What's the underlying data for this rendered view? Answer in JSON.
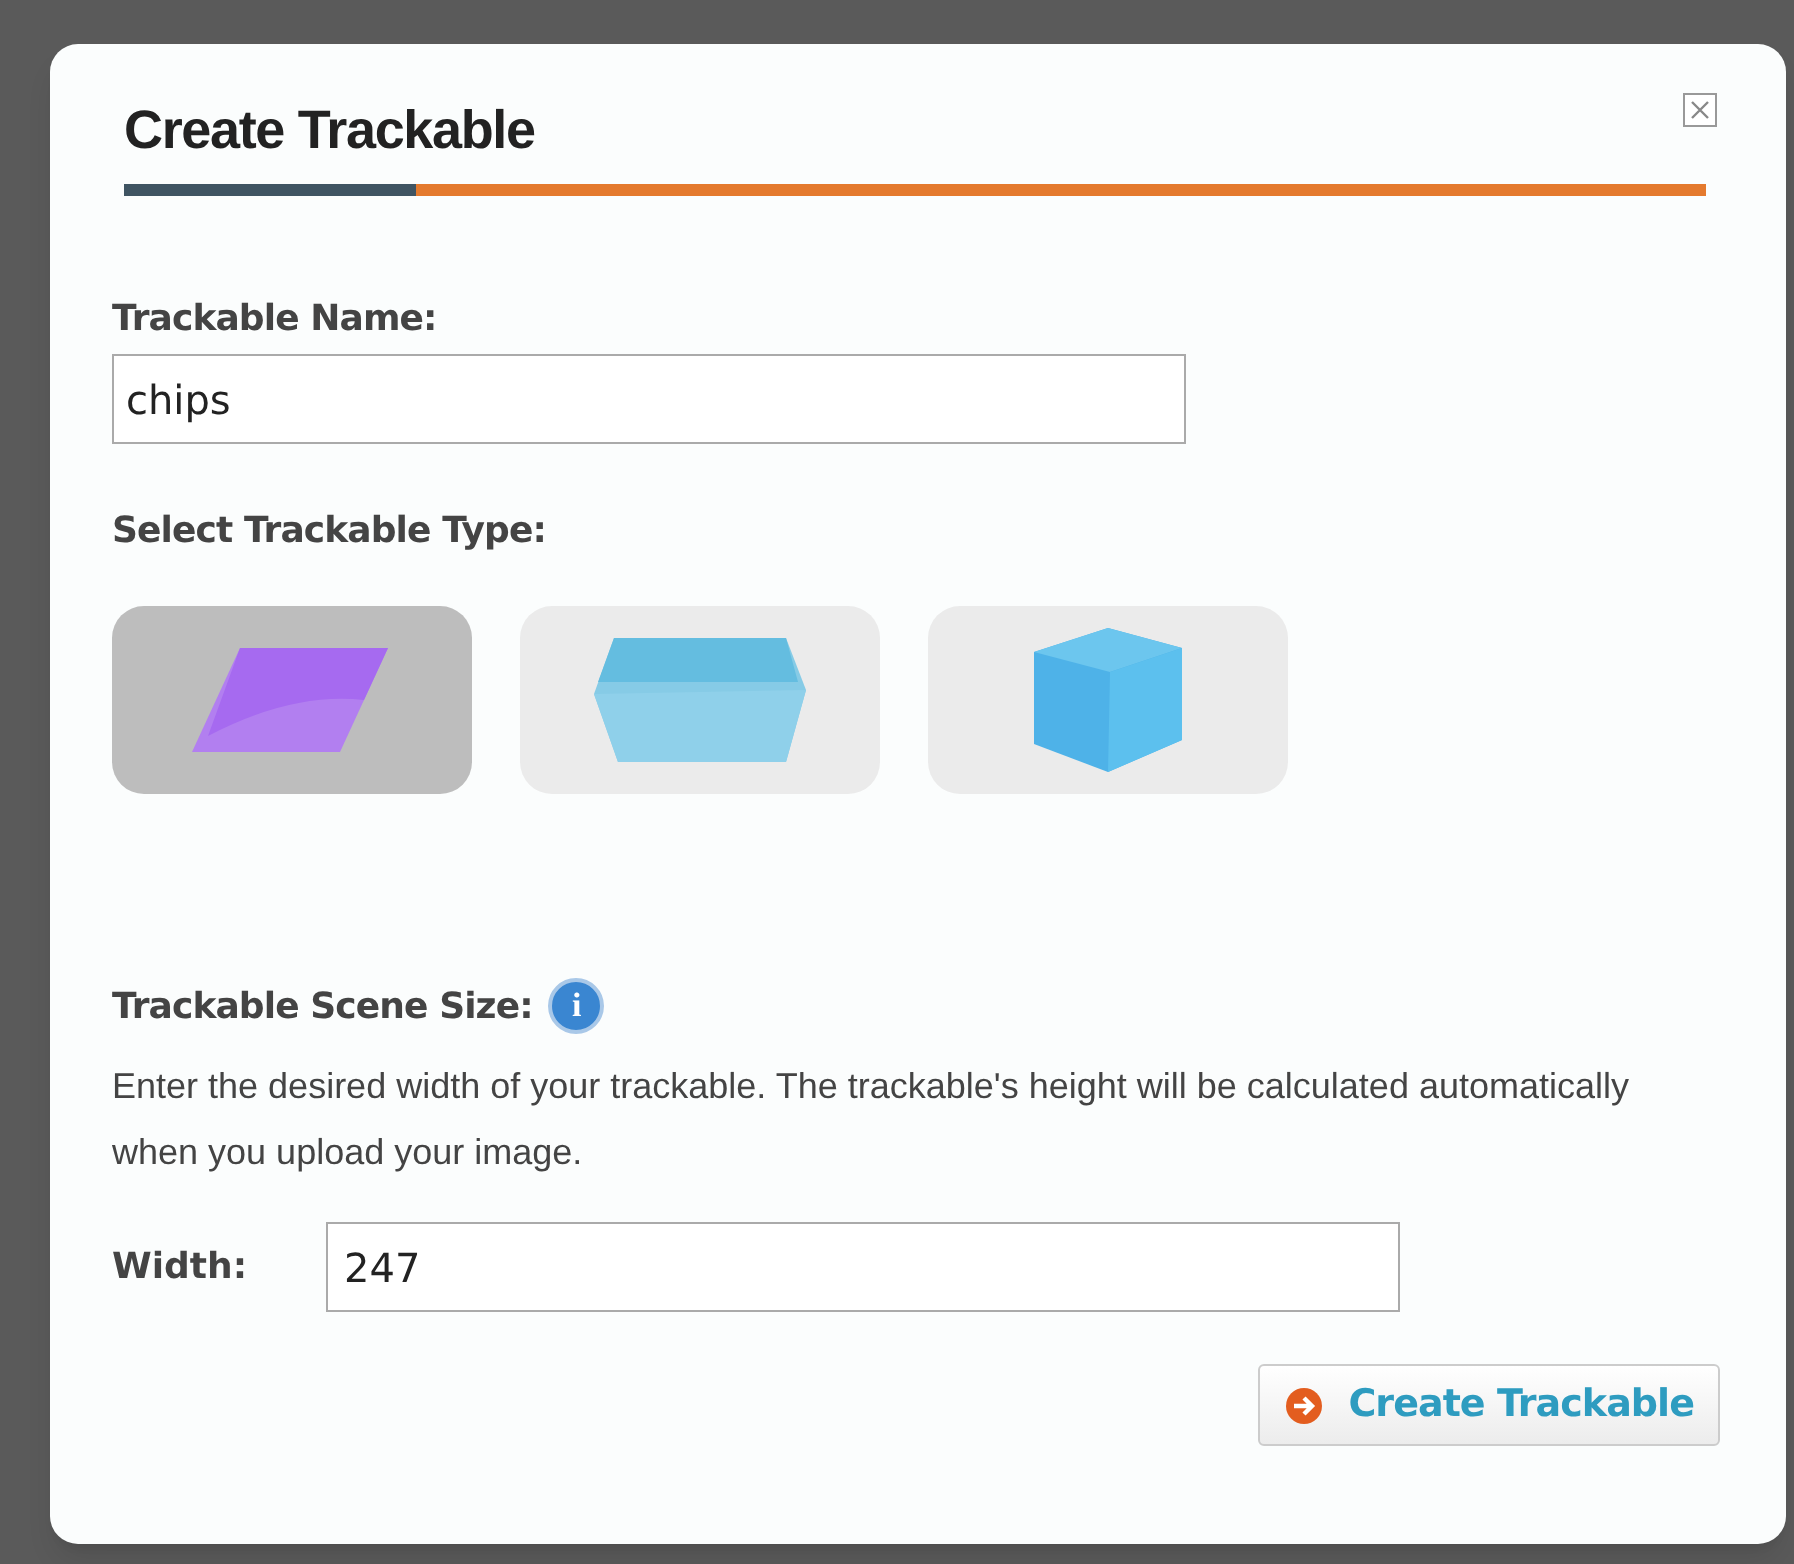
{
  "dialog": {
    "title": "Create Trackable",
    "progress": {
      "level": 0.185
    },
    "name_field": {
      "label": "Trackable Name:",
      "value": "chips"
    },
    "type_select": {
      "label": "Select Trackable Type:",
      "options": [
        {
          "kind": "plane",
          "selected": true
        },
        {
          "kind": "box",
          "selected": false
        },
        {
          "kind": "cube",
          "selected": false
        }
      ]
    },
    "scene_size": {
      "label": "Trackable Scene Size:",
      "info_icon": "i",
      "description": "Enter the desired width of your trackable. The trackable's height will be calculated automatically when you upload your image.",
      "width_field": {
        "label": "Width:",
        "value": "247"
      }
    },
    "submit_button": {
      "label": "Create Trackable"
    }
  }
}
